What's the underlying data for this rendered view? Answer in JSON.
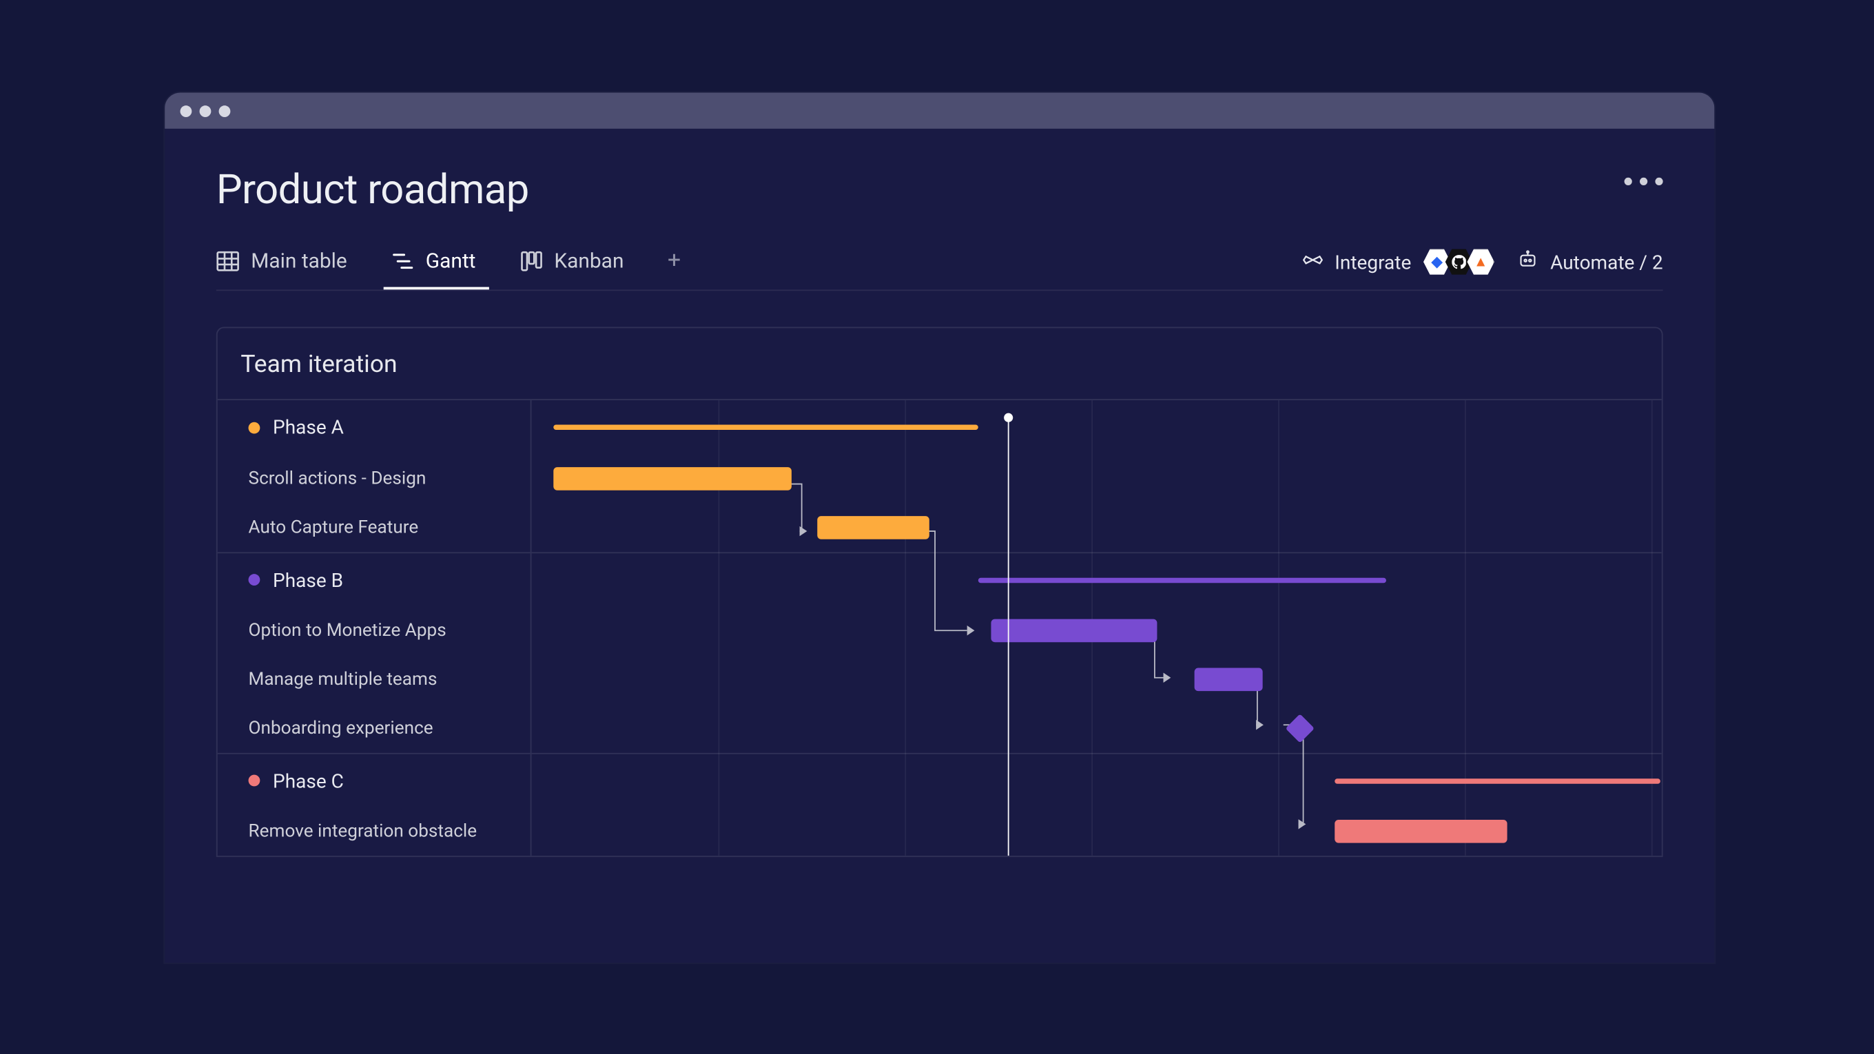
{
  "page": {
    "title": "Product roadmap"
  },
  "tabs": [
    {
      "label": "Main table"
    },
    {
      "label": "Gantt"
    },
    {
      "label": "Kanban"
    }
  ],
  "toolbar": {
    "integrate_label": "Integrate",
    "automate_label": "Automate / 2",
    "integrations": [
      "jira",
      "github",
      "gitlab"
    ]
  },
  "panel": {
    "title": "Team iteration"
  },
  "colors": {
    "phaseA": "#fdab3d",
    "phaseB": "#784bd1",
    "phaseC": "#ef7979"
  },
  "chart_data": {
    "type": "gantt",
    "x_unit": "column-index",
    "x_range": [
      0,
      6.05
    ],
    "today": 2.55,
    "groups": [
      {
        "name": "Phase A",
        "color": "phaseA",
        "summary": {
          "start": 0.12,
          "end": 2.39
        },
        "tasks": [
          {
            "name": "Scroll actions - Design",
            "start": 0.12,
            "end": 1.39,
            "dep_to": 1
          },
          {
            "name": "Auto Capture Feature",
            "start": 1.53,
            "end": 2.13
          }
        ]
      },
      {
        "name": "Phase B",
        "color": "phaseB",
        "summary": {
          "start": 2.39,
          "end": 4.58
        },
        "tasks": [
          {
            "name": "Option to Monetize Apps",
            "start": 2.46,
            "end": 3.35,
            "dep_from_prev_group_task": 1,
            "dep_to": 1
          },
          {
            "name": "Manage multiple teams",
            "start": 3.55,
            "end": 3.92,
            "dep_to": 2
          },
          {
            "name": "Onboarding experience",
            "type": "milestone",
            "at": 4.12
          }
        ]
      },
      {
        "name": "Phase C",
        "color": "phaseC",
        "summary": {
          "start": 4.3,
          "end": 6.05
        },
        "tasks": [
          {
            "name": "Remove integration obstacle",
            "start": 4.3,
            "end": 5.23,
            "dep_from_prev_group_task": 2
          }
        ]
      }
    ]
  }
}
